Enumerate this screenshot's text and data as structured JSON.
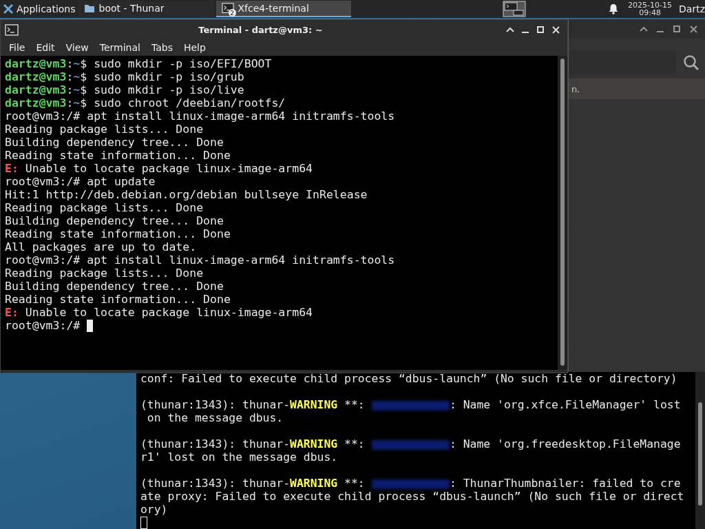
{
  "taskbar": {
    "menu_label": "Applications",
    "tasks": [
      {
        "label": "boot - Thunar",
        "selected": false
      },
      {
        "label": "Xfce4-terminal",
        "badge": "2",
        "selected": true
      }
    ],
    "date": "2025-10-15",
    "time": "09:48",
    "user": "Dartz"
  },
  "thunar_window": {
    "status_text": "n."
  },
  "terminal": {
    "title": "Terminal - dartz@vm3: ~",
    "menu": [
      "File",
      "Edit",
      "View",
      "Terminal",
      "Tabs",
      "Help"
    ],
    "lines": [
      [
        {
          "kind": "user",
          "text": "dartz@vm3"
        },
        {
          "kind": "text",
          "text": ":"
        },
        {
          "kind": "path",
          "text": "~"
        },
        {
          "kind": "text",
          "text": "$ sudo mkdir -p iso/EFI/BOOT"
        }
      ],
      [
        {
          "kind": "user",
          "text": "dartz@vm3"
        },
        {
          "kind": "text",
          "text": ":"
        },
        {
          "kind": "path",
          "text": "~"
        },
        {
          "kind": "text",
          "text": "$ sudo mkdir -p iso/grub"
        }
      ],
      [
        {
          "kind": "user",
          "text": "dartz@vm3"
        },
        {
          "kind": "text",
          "text": ":"
        },
        {
          "kind": "path",
          "text": "~"
        },
        {
          "kind": "text",
          "text": "$ sudo mkdir -p iso/live"
        }
      ],
      [
        {
          "kind": "user",
          "text": "dartz@vm3"
        },
        {
          "kind": "text",
          "text": ":"
        },
        {
          "kind": "path",
          "text": "~"
        },
        {
          "kind": "text",
          "text": "$ sudo chroot /deebian/rootfs/"
        }
      ],
      [
        {
          "kind": "text",
          "text": "root@vm3:/# apt install linux-image-arm64 initramfs-tools"
        }
      ],
      [
        {
          "kind": "text",
          "text": "Reading package lists... Done"
        }
      ],
      [
        {
          "kind": "text",
          "text": "Building dependency tree... Done"
        }
      ],
      [
        {
          "kind": "text",
          "text": "Reading state information... Done"
        }
      ],
      [
        {
          "kind": "error",
          "text": "E:"
        },
        {
          "kind": "text",
          "text": " Unable to locate package linux-image-arm64"
        }
      ],
      [
        {
          "kind": "text",
          "text": "root@vm3:/# apt update"
        }
      ],
      [
        {
          "kind": "text",
          "text": "Hit:1 http://deb.debian.org/debian bullseye InRelease"
        }
      ],
      [
        {
          "kind": "text",
          "text": "Reading package lists... Done"
        }
      ],
      [
        {
          "kind": "text",
          "text": "Building dependency tree... Done"
        }
      ],
      [
        {
          "kind": "text",
          "text": "Reading state information... Done"
        }
      ],
      [
        {
          "kind": "text",
          "text": "All packages are up to date."
        }
      ],
      [
        {
          "kind": "text",
          "text": "root@vm3:/# apt install linux-image-arm64 initramfs-tools"
        }
      ],
      [
        {
          "kind": "text",
          "text": "Reading package lists... Done"
        }
      ],
      [
        {
          "kind": "text",
          "text": "Building dependency tree... Done"
        }
      ],
      [
        {
          "kind": "text",
          "text": "Reading state information... Done"
        }
      ],
      [
        {
          "kind": "error",
          "text": "E:"
        },
        {
          "kind": "text",
          "text": " Unable to locate package linux-image-arm64"
        }
      ],
      [
        {
          "kind": "text",
          "text": "root@vm3:/# "
        },
        {
          "kind": "cursor"
        }
      ]
    ]
  },
  "back_terminal": {
    "paragraphs": [
      [
        [
          {
            "kind": "text",
            "text": "conf: Failed to execute child process “dbus-launch” (No such file or directory)"
          }
        ]
      ],
      [
        [
          {
            "kind": "text",
            "text": "(thunar:1343): thunar-"
          },
          {
            "kind": "warning",
            "text": "WARNING"
          },
          {
            "kind": "text",
            "text": " **: "
          },
          {
            "kind": "blur"
          },
          {
            "kind": "text",
            "text": ": Name 'org.xfce.FileManager' lost"
          }
        ],
        [
          {
            "kind": "text",
            "text": " on the message dbus."
          }
        ]
      ],
      [
        [
          {
            "kind": "text",
            "text": "(thunar:1343): thunar-"
          },
          {
            "kind": "warning",
            "text": "WARNING"
          },
          {
            "kind": "text",
            "text": " **: "
          },
          {
            "kind": "blur"
          },
          {
            "kind": "text",
            "text": ": Name 'org.freedesktop.FileManage"
          }
        ],
        [
          {
            "kind": "text",
            "text": "r1' lost on the message dbus."
          }
        ]
      ],
      [
        [
          {
            "kind": "text",
            "text": "(thunar:1343): thunar-"
          },
          {
            "kind": "warning",
            "text": "WARNING"
          },
          {
            "kind": "text",
            "text": " **: "
          },
          {
            "kind": "blur"
          },
          {
            "kind": "text",
            "text": ": ThunarThumbnailer: failed to cre"
          }
        ],
        [
          {
            "kind": "text",
            "text": "ate proxy: Failed to execute child process “dbus-launch” (No such file or direct"
          }
        ],
        [
          {
            "kind": "text",
            "text": "ory)"
          }
        ],
        [
          {
            "kind": "hollow_cursor"
          }
        ]
      ]
    ]
  }
}
